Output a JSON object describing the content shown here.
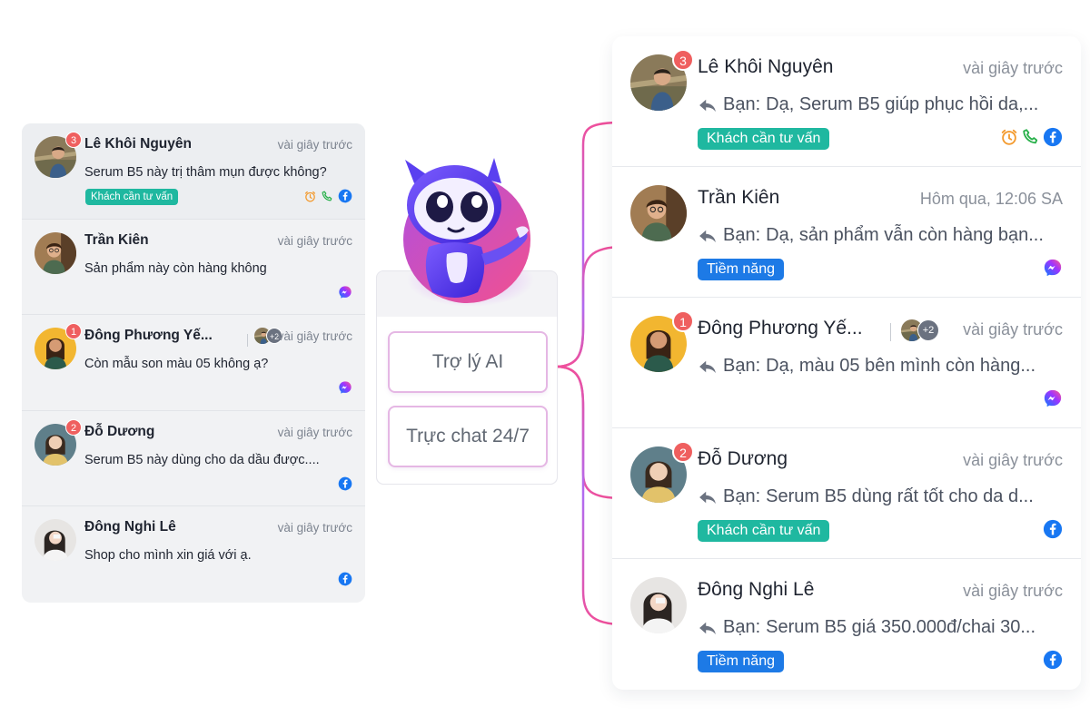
{
  "left_panel": {
    "rows": [
      {
        "name": "Lê Khôi Nguyên",
        "time": "vài giây trước",
        "message": "Serum B5 này trị thâm mụn được không?",
        "badge": "3",
        "tag": "Khách cần tư vấn",
        "channels": [
          "alarm-icon",
          "phone-icon",
          "facebook-icon"
        ]
      },
      {
        "name": "Trần Kiên",
        "time": "vài giây trước",
        "message": "Sản phẩm này còn hàng không",
        "badge": "",
        "tag": "",
        "channels": [
          "messenger-icon"
        ]
      },
      {
        "name": "Đông Phương Yế...",
        "time": "vài giây trước",
        "message": "Còn mẫu son màu 05 không ạ?",
        "badge": "1",
        "tag": "",
        "extra_count": "+2",
        "channels": [
          "messenger-icon"
        ]
      },
      {
        "name": "Đỗ Dương",
        "time": "vài giây trước",
        "message": "Serum B5 này dùng cho da dầu được....",
        "badge": "2",
        "tag": "",
        "channels": [
          "facebook-icon"
        ]
      },
      {
        "name": "Đông Nghi Lê",
        "time": "vài giây trước",
        "message": "Shop cho mình xin giá với ạ.",
        "badge": "",
        "tag": "",
        "channels": [
          "facebook-icon"
        ]
      }
    ]
  },
  "center": {
    "buttons": [
      "Trợ lý AI",
      "Trực chat 24/7"
    ]
  },
  "right_list": {
    "reply_prefix": "Bạn:",
    "rows": [
      {
        "name": "Lê Khôi Nguyên",
        "time": "vài giây trước",
        "message": "Dạ, Serum B5 giúp phục hồi da,...",
        "badge": "3",
        "tag": "Khách cần tư vấn",
        "tag_color": "#1fb8a0",
        "channels": [
          "alarm-icon",
          "phone-icon",
          "facebook-icon"
        ]
      },
      {
        "name": "Trần Kiên",
        "time": "Hôm qua, 12:06 SA",
        "message": "Dạ, sản phẩm vẫn còn hàng bạn...",
        "badge": "",
        "tag": "Tiềm năng",
        "tag_color": "#1d7ae6",
        "channels": [
          "messenger-icon"
        ]
      },
      {
        "name": "Đông Phương Yế...",
        "time": "vài giây trước",
        "message": "Dạ, màu 05 bên mình còn hàng...",
        "badge": "1",
        "tag": "",
        "extra_count": "+2",
        "channels": [
          "messenger-icon"
        ]
      },
      {
        "name": "Đỗ Dương",
        "time": "vài giây trước",
        "message": "Serum B5 dùng rất tốt cho da d...",
        "badge": "2",
        "tag": "Khách cần tư vấn",
        "tag_color": "#1fb8a0",
        "channels": [
          "facebook-icon"
        ]
      },
      {
        "name": "Đông Nghi Lê",
        "time": "vài giây trước",
        "message": "Serum B5 giá 350.000đ/chai 30...",
        "badge": "",
        "tag": "Tiềm năng",
        "tag_color": "#1d7ae6",
        "channels": [
          "facebook-icon"
        ]
      }
    ]
  },
  "colors": {
    "accent_pink": "#ef4f9b",
    "badge_red": "#ef5f5f",
    "tag_teal": "#1fb8a0",
    "tag_blue": "#1d7ae6",
    "facebook": "#1877f2"
  }
}
